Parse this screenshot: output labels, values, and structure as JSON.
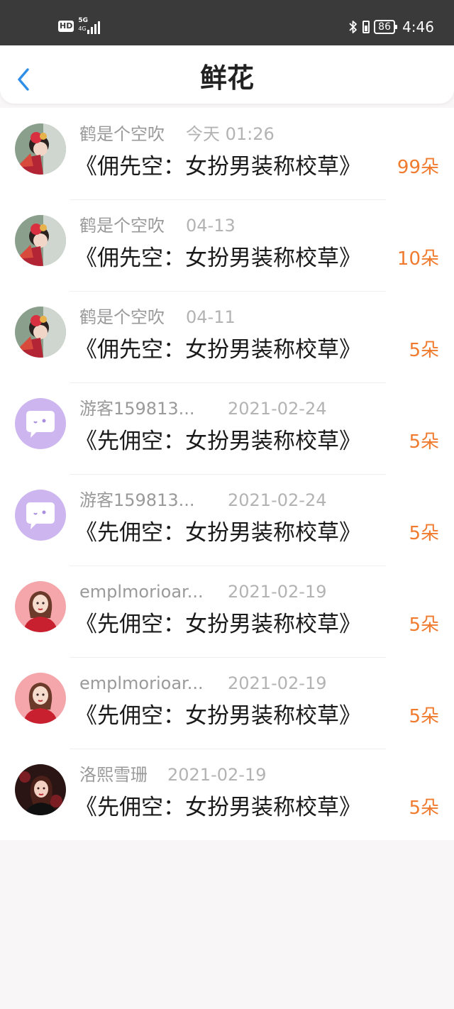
{
  "status_bar": {
    "hd": "HD",
    "network": "5G",
    "network_sub": "4G",
    "battery": "86",
    "time": "4:46"
  },
  "header": {
    "title": "鲜花"
  },
  "colors": {
    "accent": "#2f8ee8",
    "count": "#f07a2e"
  },
  "records": [
    {
      "user": "鹤是个空吹",
      "time": "今天 01:26",
      "book": "《佣先空：女扮男装称校草》",
      "count": "99朵",
      "avatar": "red-fan-girl-avatar"
    },
    {
      "user": "鹤是个空吹",
      "time": "04-13",
      "book": "《佣先空：女扮男装称校草》",
      "count": "10朵",
      "avatar": "red-fan-girl-avatar"
    },
    {
      "user": "鹤是个空吹",
      "time": "04-11",
      "book": "《佣先空：女扮男装称校草》",
      "count": "5朵",
      "avatar": "red-fan-girl-avatar"
    },
    {
      "user": "游客159813...",
      "time": "2021-02-24",
      "book": "《先佣空：女扮男装称校草》",
      "count": "5朵",
      "avatar": "chat-bubble-avatar"
    },
    {
      "user": "游客159813...",
      "time": "2021-02-24",
      "book": "《先佣空：女扮男装称校草》",
      "count": "5朵",
      "avatar": "chat-bubble-avatar"
    },
    {
      "user": "emplmorioar...",
      "time": "2021-02-19",
      "book": "《先佣空：女扮男装称校草》",
      "count": "5朵",
      "avatar": "pink-girl-avatar"
    },
    {
      "user": "emplmorioar...",
      "time": "2021-02-19",
      "book": "《先佣空：女扮男装称校草》",
      "count": "5朵",
      "avatar": "pink-girl-avatar"
    },
    {
      "user": "洛熙雪珊",
      "time": "2021-02-19",
      "book": "《先佣空：女扮男装称校草》",
      "count": "5朵",
      "avatar": "dark-girl-avatar"
    }
  ]
}
